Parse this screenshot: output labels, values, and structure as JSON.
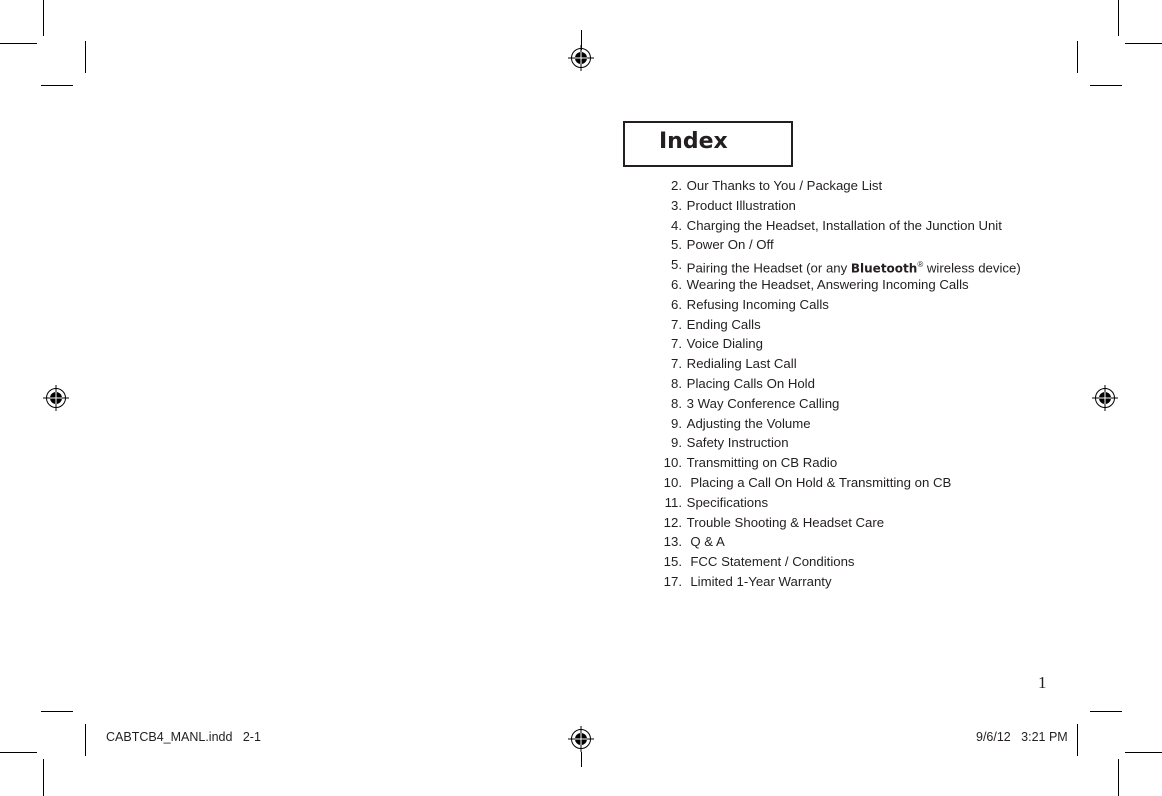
{
  "index": {
    "title": "Index",
    "entries": [
      {
        "num": "2.",
        "text": "Our Thanks to You / Package List"
      },
      {
        "num": "3.",
        "text": "Product Illustration"
      },
      {
        "num": "4.",
        "text": "Charging the Headset, Installation of the Junction Unit"
      },
      {
        "num": "5.",
        "text": "Power On / Off"
      },
      {
        "num": "5.",
        "text_before": "Pairing the Headset (or any ",
        "brand": "Bluetooth",
        "reg": "®",
        "text_after": " wireless device)"
      },
      {
        "num": "6.",
        "text": "Wearing the Headset, Answering Incoming Calls"
      },
      {
        "num": "6.",
        "text": "Refusing Incoming Calls"
      },
      {
        "num": "7.",
        "text": "Ending Calls"
      },
      {
        "num": "7.",
        "text": "Voice Dialing"
      },
      {
        "num": "7.",
        "text": "Redialing Last Call"
      },
      {
        "num": "8.",
        "text": "Placing Calls On Hold"
      },
      {
        "num": "8.",
        "text": "3 Way Conference Calling"
      },
      {
        "num": "9.",
        "text": "Adjusting the Volume"
      },
      {
        "num": "9.",
        "text": "Safety Instruction"
      },
      {
        "num": "10.",
        "text": "Transmitting on CB Radio"
      },
      {
        "num": "10.",
        "text": " Placing a Call On Hold & Transmitting on CB"
      },
      {
        "num": "11.",
        "text": "Specifications"
      },
      {
        "num": "12.",
        "text": "Trouble Shooting & Headset Care"
      },
      {
        "num": "13.",
        "text": " Q & A"
      },
      {
        "num": "15.",
        "text": " FCC Statement / Conditions"
      },
      {
        "num": "17.",
        "text": " Limited 1-Year Warranty"
      }
    ]
  },
  "page_number": "1",
  "slug": {
    "file": "CABTCB4_MANL.indd   2-1",
    "datetime": "9/6/12   3:21 PM"
  }
}
